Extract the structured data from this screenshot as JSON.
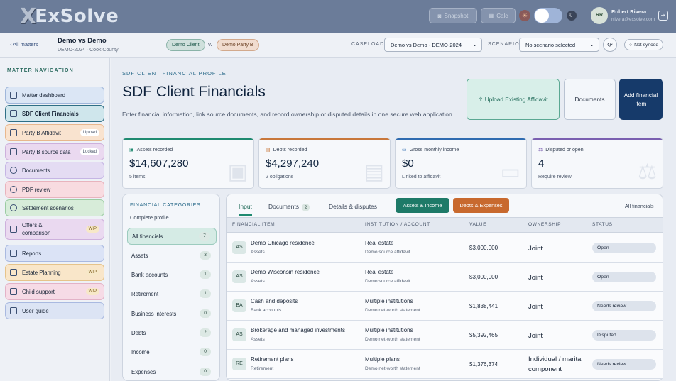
{
  "app": {
    "logo_mark": "X",
    "logo_text": "ExSolve"
  },
  "topbar": {
    "snapshot_label": "Snapshot",
    "calc_label": "Calc",
    "user_initials": "RR",
    "user_name": "Robert Rivera",
    "user_email": "rrivera@exsolve.com"
  },
  "case": {
    "back_label": "‹ All matters",
    "title": "Demo vs Demo",
    "subtitle": "DEMO-2024 · Cook County",
    "party_a": "Demo Client",
    "vs": "v.",
    "party_b": "Demo Party B",
    "caseload_label": "CASELOAD",
    "caseload_value": "Demo vs Demo - DEMO-2024",
    "scenario_label": "SCENARIO",
    "scenario_value": "No scenario selected",
    "sync_label": "Not synced"
  },
  "sidebar": {
    "title": "MATTER NAVIGATION",
    "items": [
      {
        "label": "Matter dashboard",
        "color": "#dbe6f5",
        "border": "#9fb6da"
      },
      {
        "label": "SDF Client Financials",
        "color": "#cfe6ec",
        "border": "#2f6f86"
      },
      {
        "label": "Party B Affidavit",
        "color": "#f9e3cf",
        "border": "#e8b78d",
        "badge": "Upload"
      },
      {
        "label": "Party B source data",
        "color": "#ead9f0",
        "border": "#cdb0dc",
        "badge": "Locked"
      },
      {
        "label": "Documents",
        "color": "#e4dcf3",
        "border": "#c5b5e4"
      },
      {
        "label": "PDF review",
        "color": "#f8dbe0",
        "border": "#e8b3bd"
      },
      {
        "label": "Settlement scenarios",
        "color": "#d7ecd9",
        "border": "#9bcba2"
      },
      {
        "label": "Offers & comparison",
        "color": "#ead9f0",
        "border": "#cdb0dc",
        "wip": "WIP"
      },
      {
        "label": "Reports",
        "color": "#dbe3f6",
        "border": "#a9b9e0"
      },
      {
        "label": "Estate Planning",
        "color": "#f9e6c9",
        "border": "#e6c38a",
        "wip": "WIP"
      },
      {
        "label": "Child support",
        "color": "#f6dbe6",
        "border": "#e3b2c7",
        "wip": "WIP"
      },
      {
        "label": "User guide",
        "color": "#dce4f4",
        "border": "#a9b9e0"
      }
    ]
  },
  "page": {
    "eyebrow": "SDF CLIENT FINANCIAL PROFILE",
    "title": "SDF Client Financials",
    "description": "Enter financial information, link source documents, and record ownership or disputed details in one secure web application.",
    "upload_label": "⇧ Upload Existing Affidavit",
    "documents_label": "Documents",
    "add_label": "Add financial item"
  },
  "stats": [
    {
      "label": "Assets recorded",
      "value": "$14,607,280",
      "note": "5 items",
      "color": "#1f8a70",
      "icon": "▣"
    },
    {
      "label": "Debts recorded",
      "value": "$4,297,240",
      "note": "2 obligations",
      "color": "#c8773a",
      "icon": "▤"
    },
    {
      "label": "Gross monthly income",
      "value": "$0",
      "note": "Linked to affidavit",
      "color": "#2f6bb0",
      "icon": "▭"
    },
    {
      "label": "Disputed or open",
      "value": "4",
      "note": "Require review",
      "color": "#7a5fb0",
      "icon": "⚖"
    }
  ],
  "categories": {
    "title": "FINANCIAL CATEGORIES",
    "subtitle": "Complete profile",
    "items": [
      {
        "label": "All financials",
        "count": "7"
      },
      {
        "label": "Assets",
        "count": "3"
      },
      {
        "label": "Bank accounts",
        "count": "1"
      },
      {
        "label": "Retirement",
        "count": "1"
      },
      {
        "label": "Business interests",
        "count": "0"
      },
      {
        "label": "Debts",
        "count": "2"
      },
      {
        "label": "Income",
        "count": "0"
      },
      {
        "label": "Expenses",
        "count": "0"
      }
    ]
  },
  "table": {
    "tabs": {
      "input": "Input",
      "documents": "Documents",
      "documents_count": "2",
      "details": "Details & disputes"
    },
    "filter_assets": "Assets & Income",
    "filter_debts": "Debts & Expenses",
    "all_label": "All financials",
    "headers": [
      "FINANCIAL ITEM",
      "INSTITUTION / ACCOUNT",
      "VALUE",
      "OWNERSHIP",
      "STATUS"
    ],
    "rows": [
      {
        "ini": "AS",
        "item": "Demo Chicago residence",
        "cat": "Assets",
        "inst": "Real estate",
        "src": "Demo source affidavit",
        "value": "$3,000,000",
        "own": "Joint",
        "status": "Open"
      },
      {
        "ini": "AS",
        "item": "Demo Wisconsin residence",
        "cat": "Assets",
        "inst": "Real estate",
        "src": "Demo source affidavit",
        "value": "$3,000,000",
        "own": "Joint",
        "status": "Open"
      },
      {
        "ini": "BA",
        "item": "Cash and deposits",
        "cat": "Bank accounts",
        "inst": "Multiple institutions",
        "src": "Demo net-worth statement",
        "value": "$1,838,441",
        "own": "Joint",
        "status": "Needs review"
      },
      {
        "ini": "AS",
        "item": "Brokerage and managed investments",
        "cat": "Assets",
        "inst": "Multiple institutions",
        "src": "Demo net-worth statement",
        "value": "$5,392,465",
        "own": "Joint",
        "status": "Disputed"
      },
      {
        "ini": "RE",
        "item": "Retirement plans",
        "cat": "Retirement",
        "inst": "Multiple plans",
        "src": "Demo net-worth statement",
        "value": "$1,376,374",
        "own": "Individual / marital component",
        "status": "Needs review"
      }
    ]
  }
}
